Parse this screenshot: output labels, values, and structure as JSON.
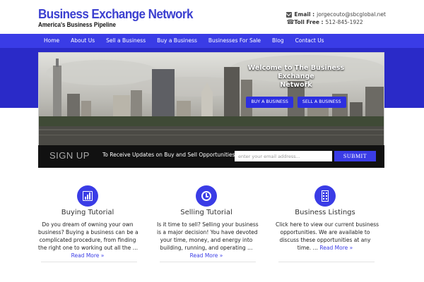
{
  "header": {
    "title": "Business Exchange Network",
    "tagline": "America's Business Pipeline",
    "email_label": "Email :",
    "email_value": "jorgecouto@sbcglobal.net",
    "phone_label": "Toll Free :",
    "phone_value": "512-845-1922"
  },
  "nav": {
    "items": [
      {
        "label": "Home"
      },
      {
        "label": "About Us"
      },
      {
        "label": "Sell a Business"
      },
      {
        "label": "Buy a Business"
      },
      {
        "label": "Businesses For Sale"
      },
      {
        "label": "Blog"
      },
      {
        "label": "Contact Us"
      }
    ]
  },
  "hero": {
    "title_line1": "Welcome to The Business Exchange",
    "title_line2": "Network",
    "buy_button": "BUY A BUSINESS",
    "sell_button": "SELL A BUSINESS"
  },
  "signup": {
    "heading": "SIGN UP",
    "text": "To Receive Updates on Buy and Sell Opportunities",
    "placeholder": "enter your email address...",
    "submit": "SUBMIT"
  },
  "features": [
    {
      "title": "Buying Tutorial",
      "icon": "chart-icon",
      "lines": [
        "Do you dream of owning your own",
        "business? Buying a business can be a",
        "complicated procedure, from finding",
        "the right one to working out all the …"
      ],
      "read_more": "Read More »"
    },
    {
      "title": "Selling Tutorial",
      "icon": "clock-icon",
      "lines": [
        "Is it time to sell? Selling your business",
        "is a major decision! You have devoted",
        "your time, money, and energy into",
        "building, running, and operating …"
      ],
      "read_more": "Read More »"
    },
    {
      "title": "Business Listings",
      "icon": "building-icon",
      "lines": [
        "Click here to view our current business",
        "opportunities. We are available to",
        "discuss these opportunities at any",
        "time. …"
      ],
      "read_more": "Read More »"
    }
  ],
  "colors": {
    "accent": "#3a3ce6",
    "brand_title": "#3b3fd0",
    "hero_band": "#2a2ac8",
    "signup_bg": "#111111"
  }
}
